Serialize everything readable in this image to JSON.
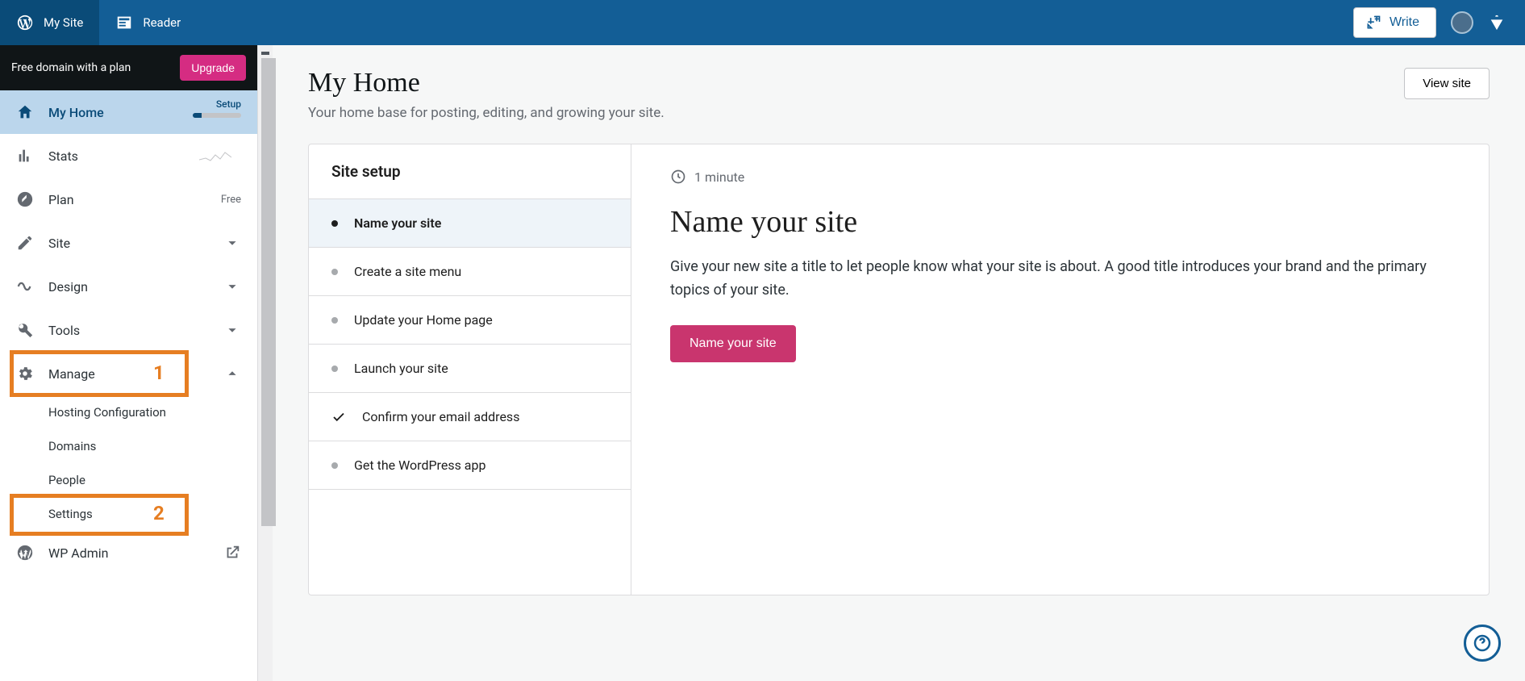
{
  "topbar": {
    "my_site": "My Site",
    "reader": "Reader",
    "write": "Write"
  },
  "sidebar": {
    "promo_text": "Free domain with a plan",
    "upgrade_label": "Upgrade",
    "items": [
      {
        "label": "My Home",
        "setup_label": "Setup"
      },
      {
        "label": "Stats"
      },
      {
        "label": "Plan",
        "right": "Free"
      },
      {
        "label": "Site"
      },
      {
        "label": "Design"
      },
      {
        "label": "Tools"
      },
      {
        "label": "Manage"
      }
    ],
    "sub_items": [
      "Hosting Configuration",
      "Domains",
      "People",
      "Settings"
    ],
    "wp_admin": "WP Admin"
  },
  "annotations": {
    "box1": "1",
    "box2": "2"
  },
  "page": {
    "title": "My Home",
    "subtitle": "Your home base for posting, editing, and growing your site.",
    "view_site": "View site"
  },
  "setup": {
    "title": "Site setup",
    "items": [
      "Name your site",
      "Create a site menu",
      "Update your Home page",
      "Launch your site",
      "Confirm your email address",
      "Get the WordPress app"
    ]
  },
  "detail": {
    "time": "1 minute",
    "title": "Name your site",
    "desc": "Give your new site a title to let people know what your site is about. A good title introduces your brand and the primary topics of your site.",
    "cta": "Name your site"
  }
}
